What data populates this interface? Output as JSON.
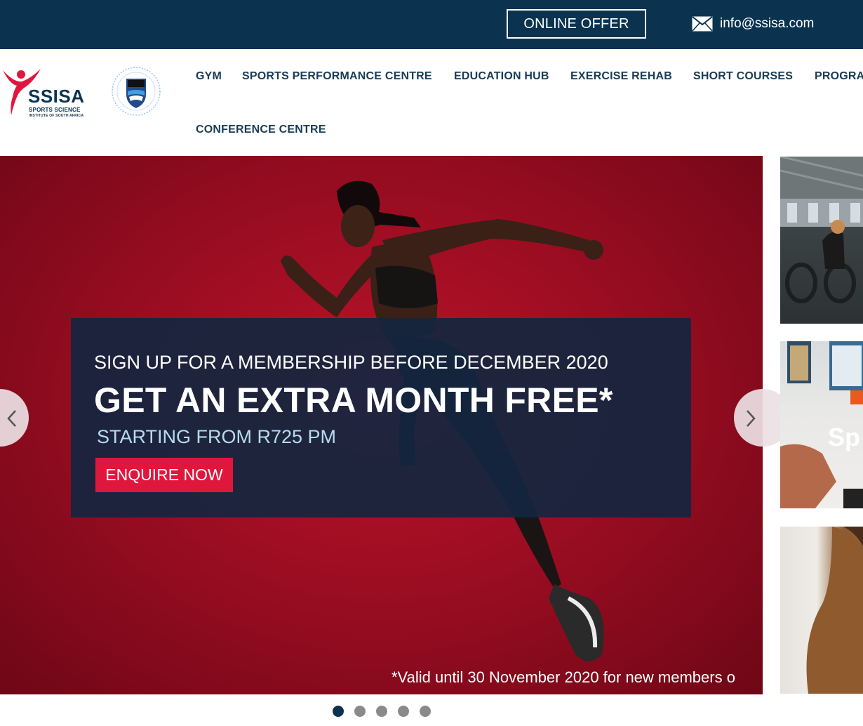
{
  "topbar": {
    "online_offer_label": "ONLINE OFFER",
    "email": "info@ssisa.com",
    "background_color": "#0b3350"
  },
  "header": {
    "logo": {
      "brand": "SSISA",
      "tagline": "SPORTS SCIENCE",
      "subtagline": "INSTITUTE OF SOUTH AFRICA",
      "brand_color": "#e0173c"
    },
    "nav_items": [
      "GYM",
      "SPORTS PERFORMANCE CENTRE",
      "EDUCATION HUB",
      "EXERCISE REHAB",
      "SHORT COURSES",
      "PROGRA",
      "CONFERENCE CENTRE"
    ]
  },
  "hero": {
    "line1": "SIGN UP FOR A MEMBERSHIP BEFORE DECEMBER 2020",
    "line2": "GET AN EXTRA MONTH FREE*",
    "line3": "STARTING FROM R725 PM",
    "cta_label": "ENQUIRE NOW",
    "fineprint": "*Valid until 30 November 2020 for new members o",
    "accent_color": "#e0173c",
    "background_color": "#9c0d22",
    "box_color": "#142640"
  },
  "side_thumbs": [
    {
      "label": ""
    },
    {
      "label": "Sp"
    },
    {
      "label": ""
    }
  ],
  "slider": {
    "slide_count": 5,
    "active_index": 0
  },
  "icons": {
    "email": "envelope-icon",
    "prev": "chevron-left-icon",
    "next": "chevron-right-icon"
  }
}
